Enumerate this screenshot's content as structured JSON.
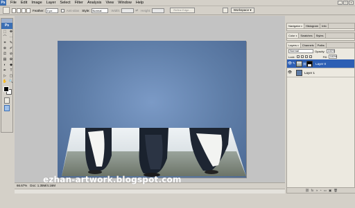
{
  "menu": {
    "logo": "Ps",
    "items": [
      "File",
      "Edit",
      "Image",
      "Layer",
      "Select",
      "Filter",
      "Analysis",
      "View",
      "Window",
      "Help"
    ],
    "minimize": "_",
    "maximize": "□",
    "close": "x"
  },
  "options": {
    "feather_label": "Feather:",
    "feather_value": "0 px",
    "antialias_label": "Anti-alias",
    "style_label": "Style:",
    "style_value": "Normal",
    "width_label": "Width:",
    "height_label": "Height:",
    "refine_label": "Refine Edge...",
    "workspace_label": "Workspace ▾"
  },
  "toolbox": {
    "logo": "Ps",
    "tools": [
      "⬚",
      "✥",
      "⌒",
      "⋯",
      "⌗",
      "✎",
      "⊕",
      "✐",
      "⎚",
      "⊘",
      "▤",
      "✿",
      "◐",
      "◆",
      "✒",
      "T",
      "▷",
      "▢",
      "✋",
      "🔍"
    ]
  },
  "status": {
    "zoom": "66.67%",
    "doc": "Doc: 1.35M/4.16M"
  },
  "watermark": "ezhan-artwork.blogspot.com",
  "panels": {
    "top_tabs": [
      "Navigator",
      "Histogram",
      "Info"
    ],
    "mid_tabs": [
      "Color",
      "Swatches",
      "Styles"
    ],
    "layer_tabs": [
      "Layers",
      "Channels",
      "Paths"
    ],
    "blend_mode": "Normal",
    "opacity_label": "Opacity:",
    "opacity_value": "100%",
    "lock_label": "Lock:",
    "fill_label": "Fill:",
    "fill_value": "100%",
    "tab_close": "x",
    "layers": [
      {
        "name": "Layer 0",
        "selected": true
      },
      {
        "name": "Layer 1",
        "selected": false
      }
    ],
    "footer_icons": [
      "⛓",
      "fx",
      "◑",
      "◔",
      "▭",
      "▣",
      "🗑"
    ]
  }
}
